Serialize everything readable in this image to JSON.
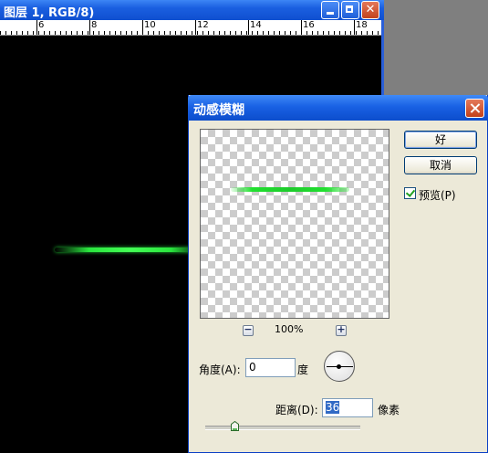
{
  "document": {
    "title": "图层 1, RGB/8)",
    "ruler_labels": [
      "6",
      "8",
      "10",
      "12",
      "14",
      "16",
      "18"
    ]
  },
  "dialog": {
    "title": "动感模糊",
    "ok_label": "好",
    "cancel_label": "取消",
    "preview_label": "预览(P)",
    "preview_checked": true,
    "zoom_level": "100%",
    "zoom_out_glyph": "−",
    "zoom_in_glyph": "+",
    "angle_label": "角度(A):",
    "angle_value": "0",
    "angle_unit": "度",
    "distance_label": "距离(D):",
    "distance_value": "36",
    "distance_unit": "像素"
  },
  "colors": {
    "streak": "#2ae53e",
    "titlebar": "#1961e4",
    "dialog_bg": "#ece9d8"
  }
}
